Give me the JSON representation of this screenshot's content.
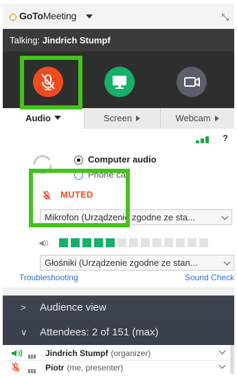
{
  "app": {
    "brand_bold": "GoTo",
    "brand_rest": "Meeting"
  },
  "talking": {
    "prefix": "Talking: ",
    "name": "Jindrich Stumpf"
  },
  "controls": [
    {
      "name": "mic",
      "icon": "microphone-muted-icon",
      "color": "#f04b20",
      "state": "muted"
    },
    {
      "name": "screen",
      "icon": "screen-share-icon",
      "color": "#15b06a"
    },
    {
      "name": "webcam",
      "icon": "webcam-icon",
      "color": "#5a5f6a"
    }
  ],
  "tabs": {
    "audio": "Audio",
    "screen": "Screen",
    "webcam": "Webcam"
  },
  "audio": {
    "help": "?",
    "computer_audio": "Computer audio",
    "phone_call": "Phone call",
    "muted_label": "MUTED",
    "microphone_device": "Mikrofon (Urządzenie zgodne ze sta...",
    "speaker_device": "Głośniki (Urządzenie zgodne ze stan...",
    "output_level": {
      "filled": 5,
      "total": 13
    },
    "troubleshooting": "Troubleshooting",
    "sound_check": "Sound Check"
  },
  "sections": {
    "audience_view": "Audience view",
    "attendees": "Attendees: 2 of 151 (max)"
  },
  "attendees": [
    {
      "name": "Jindrich Stumpf",
      "role": "(organizer)",
      "status": "speaking"
    },
    {
      "name": "Piotr",
      "role": "(me, presenter)",
      "status": "muted"
    }
  ],
  "colors": {
    "accent_orange": "#f04b20",
    "green": "#15b06a",
    "highlight": "#43c41a",
    "link": "#2d6fd0"
  }
}
